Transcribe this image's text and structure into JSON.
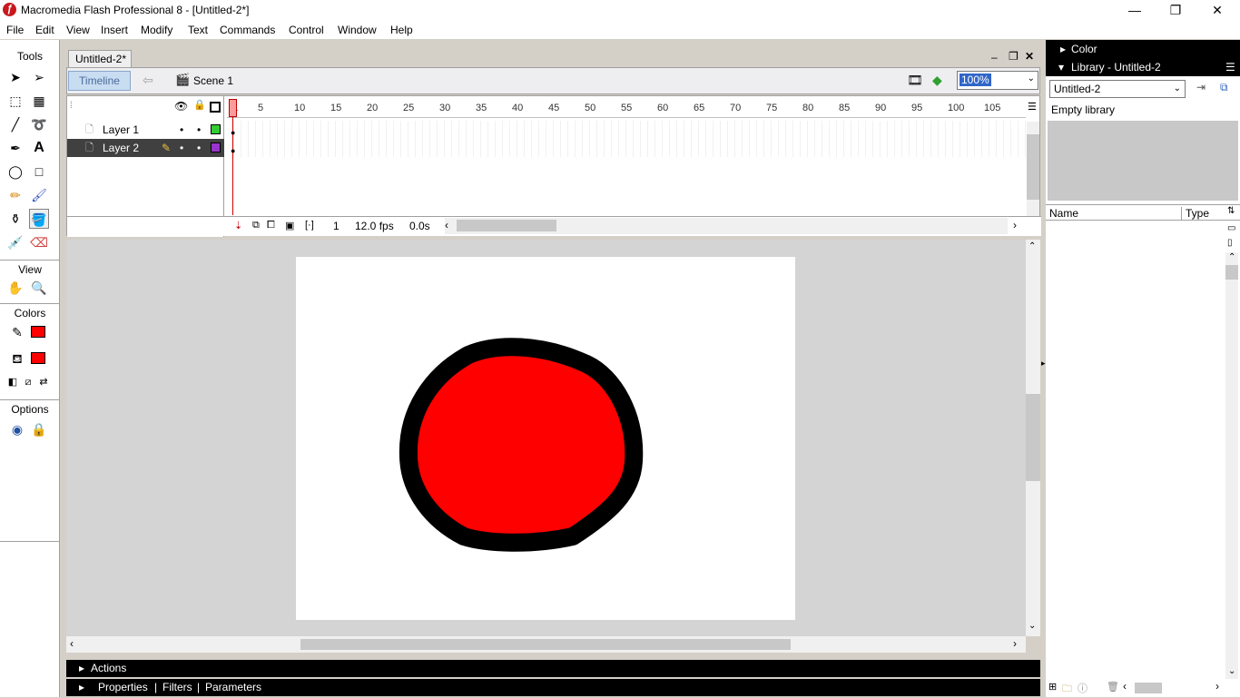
{
  "window": {
    "title": "Macromedia Flash Professional 8 - [Untitled-2*]",
    "minimize": "—",
    "maximize": "❐",
    "close": "✕"
  },
  "menu": [
    "File",
    "Edit",
    "View",
    "Insert",
    "Modify",
    "Text",
    "Commands",
    "Control",
    "Window",
    "Help"
  ],
  "tools": {
    "header": "Tools",
    "view_header": "View",
    "colors_header": "Colors",
    "options_header": "Options",
    "stroke_color": "#ff0000",
    "fill_color": "#ff0000"
  },
  "document": {
    "tab": "Untitled-2*",
    "timeline_button": "Timeline",
    "scene": "Scene 1",
    "zoom": "100%"
  },
  "timeline": {
    "layers": [
      {
        "name": "Layer 1",
        "selected": false,
        "color": "#33cc33"
      },
      {
        "name": "Layer 2",
        "selected": true,
        "color": "#9933cc"
      }
    ],
    "frame_numbers": [
      "1",
      "5",
      "10",
      "15",
      "20",
      "25",
      "30",
      "35",
      "40",
      "45",
      "50",
      "55",
      "60",
      "65",
      "70",
      "75",
      "80",
      "85",
      "90",
      "95",
      "100",
      "105"
    ],
    "current_frame": "1",
    "fps": "12.0 fps",
    "time": "0.0s"
  },
  "stage": {
    "shape_fill": "#ff0000",
    "shape_stroke": "#000000"
  },
  "bottom_panels": {
    "actions": "Actions",
    "properties": "Properties",
    "filters": "Filters",
    "parameters": "Parameters"
  },
  "right_panel": {
    "color_header": "Color",
    "library_header": "Library - Untitled-2",
    "library_select": "Untitled-2",
    "empty_library": "Empty library",
    "col_name": "Name",
    "col_type": "Type"
  }
}
